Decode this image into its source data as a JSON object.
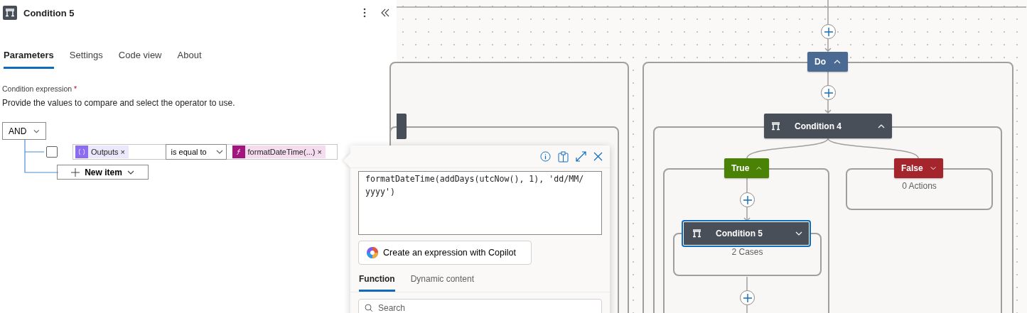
{
  "panel": {
    "title": "Condition 5",
    "tabs": [
      {
        "label": "Parameters",
        "selected": true
      },
      {
        "label": "Settings",
        "selected": false
      },
      {
        "label": "Code view",
        "selected": false
      },
      {
        "label": "About",
        "selected": false
      }
    ],
    "field_label": "Condition expression",
    "required_mark": "*",
    "description": "Provide the values to compare and select the operator to use.",
    "group_operator": "AND",
    "rows": [
      {
        "checked": false,
        "left_token": "Outputs",
        "operator": "is equal to",
        "right_token": "formatDateTime(...)",
        "remove_mark": "×"
      }
    ],
    "new_item": "New item"
  },
  "expression_editor": {
    "expression": "formatDateTime(addDays(utcNow(), 1), 'dd/MM/yyyy')",
    "copilot_button": "Create an expression with Copilot",
    "tabs": [
      {
        "label": "Function",
        "selected": true
      },
      {
        "label": "Dynamic content",
        "selected": false
      }
    ],
    "search": {
      "placeholder": "Search"
    }
  },
  "canvas": {
    "nodes": [
      {
        "kind": "scope",
        "label": "Do",
        "expanded": true,
        "selected": false
      },
      {
        "kind": "condition",
        "label": "Condition 4",
        "expanded": true,
        "selected": false
      },
      {
        "kind": "true",
        "label": "True",
        "expanded": true,
        "selected": false
      },
      {
        "kind": "false",
        "label": "False",
        "expanded": false,
        "selected": false,
        "summary": "0 Actions"
      },
      {
        "kind": "condition",
        "label": "Condition 5",
        "expanded": false,
        "selected": true,
        "summary": "2 Cases"
      }
    ]
  }
}
